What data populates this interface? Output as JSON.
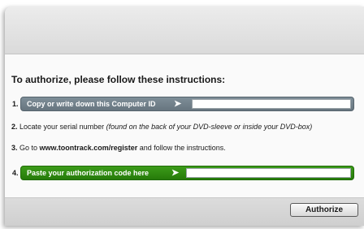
{
  "instructions": {
    "heading": "To authorize, please follow these instructions:",
    "step1": {
      "number": "1.",
      "label": "Copy  or write down this Computer ID",
      "arrow": "➤",
      "computer_id_value": ""
    },
    "step2": {
      "number": "2.",
      "text": "Locate your serial number ",
      "note": "(found on the back of your DVD-sleeve or inside your DVD-box)"
    },
    "step3": {
      "number": "3.",
      "prefix": "Go to ",
      "url": "www.toontrack.com/register",
      "suffix": " and follow the instructions."
    },
    "step4": {
      "number": "4.",
      "label": "Paste your authorization code here",
      "arrow": "➤",
      "auth_code_value": ""
    }
  },
  "footer": {
    "authorize_label": "Authorize"
  },
  "colors": {
    "step1_bar": "#6f7e88",
    "step4_bar": "#2e8a10"
  }
}
